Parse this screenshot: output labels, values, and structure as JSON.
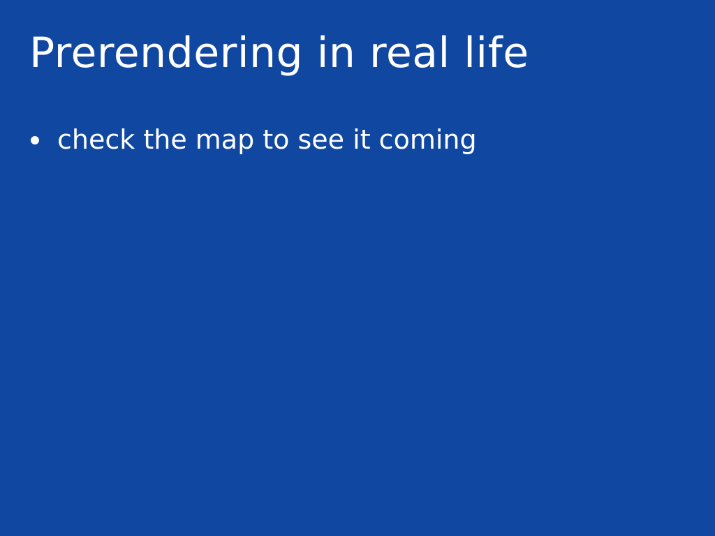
{
  "slide": {
    "title": "Prerendering in real life",
    "bullets": [
      {
        "text": "check the map to see it coming"
      }
    ]
  },
  "colors": {
    "background": "#0f47a1",
    "text": "#ffffff"
  }
}
